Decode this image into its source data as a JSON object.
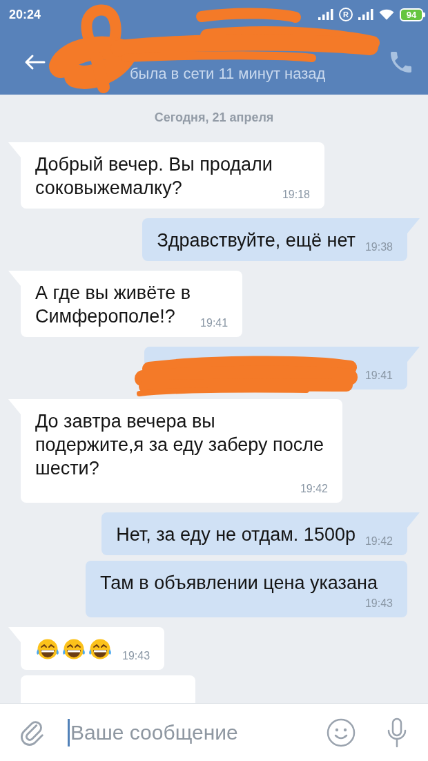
{
  "status_bar": {
    "time": "20:24",
    "roaming": "R",
    "battery": "94"
  },
  "header": {
    "redacted": true,
    "last_seen": "была в сети 11 минут назад"
  },
  "date_label": "Сегодня, 21 апреля",
  "messages": [
    {
      "outgoing": false,
      "kind": "text",
      "tail": true,
      "text": "Добрый вечер. Вы продали\nсоковыжемалку?",
      "time": "19:18"
    },
    {
      "outgoing": true,
      "kind": "text",
      "tail": true,
      "text": "Здравствуйте, ещё нет",
      "time": "19:38"
    },
    {
      "outgoing": false,
      "kind": "text",
      "tail": true,
      "text": "А где вы живёте в\nСимферополе!?",
      "time": "19:41"
    },
    {
      "outgoing": true,
      "kind": "redacted",
      "tail": true,
      "time": "19:41"
    },
    {
      "outgoing": false,
      "kind": "text",
      "tail": true,
      "text": "До завтра вечера вы\nподержите,я за еду заберу после\nшести?",
      "time": "19:42"
    },
    {
      "outgoing": true,
      "kind": "text",
      "tail": true,
      "text": "Нет, за еду не отдам. 1500р",
      "time": "19:42"
    },
    {
      "outgoing": true,
      "kind": "text",
      "tail": false,
      "text": "Там в объявлении цена указана",
      "time": "19:43"
    },
    {
      "outgoing": false,
      "kind": "emoji",
      "tail": true,
      "emojis": [
        {
          "kind": "tears-of-joy"
        },
        {
          "kind": "tears-of-joy"
        },
        {
          "kind": "tears-of-joy"
        }
      ],
      "time": "19:43"
    },
    {
      "outgoing": false,
      "kind": "cut",
      "tail": false
    }
  ],
  "composer": {
    "placeholder": "Ваше сообщение"
  }
}
